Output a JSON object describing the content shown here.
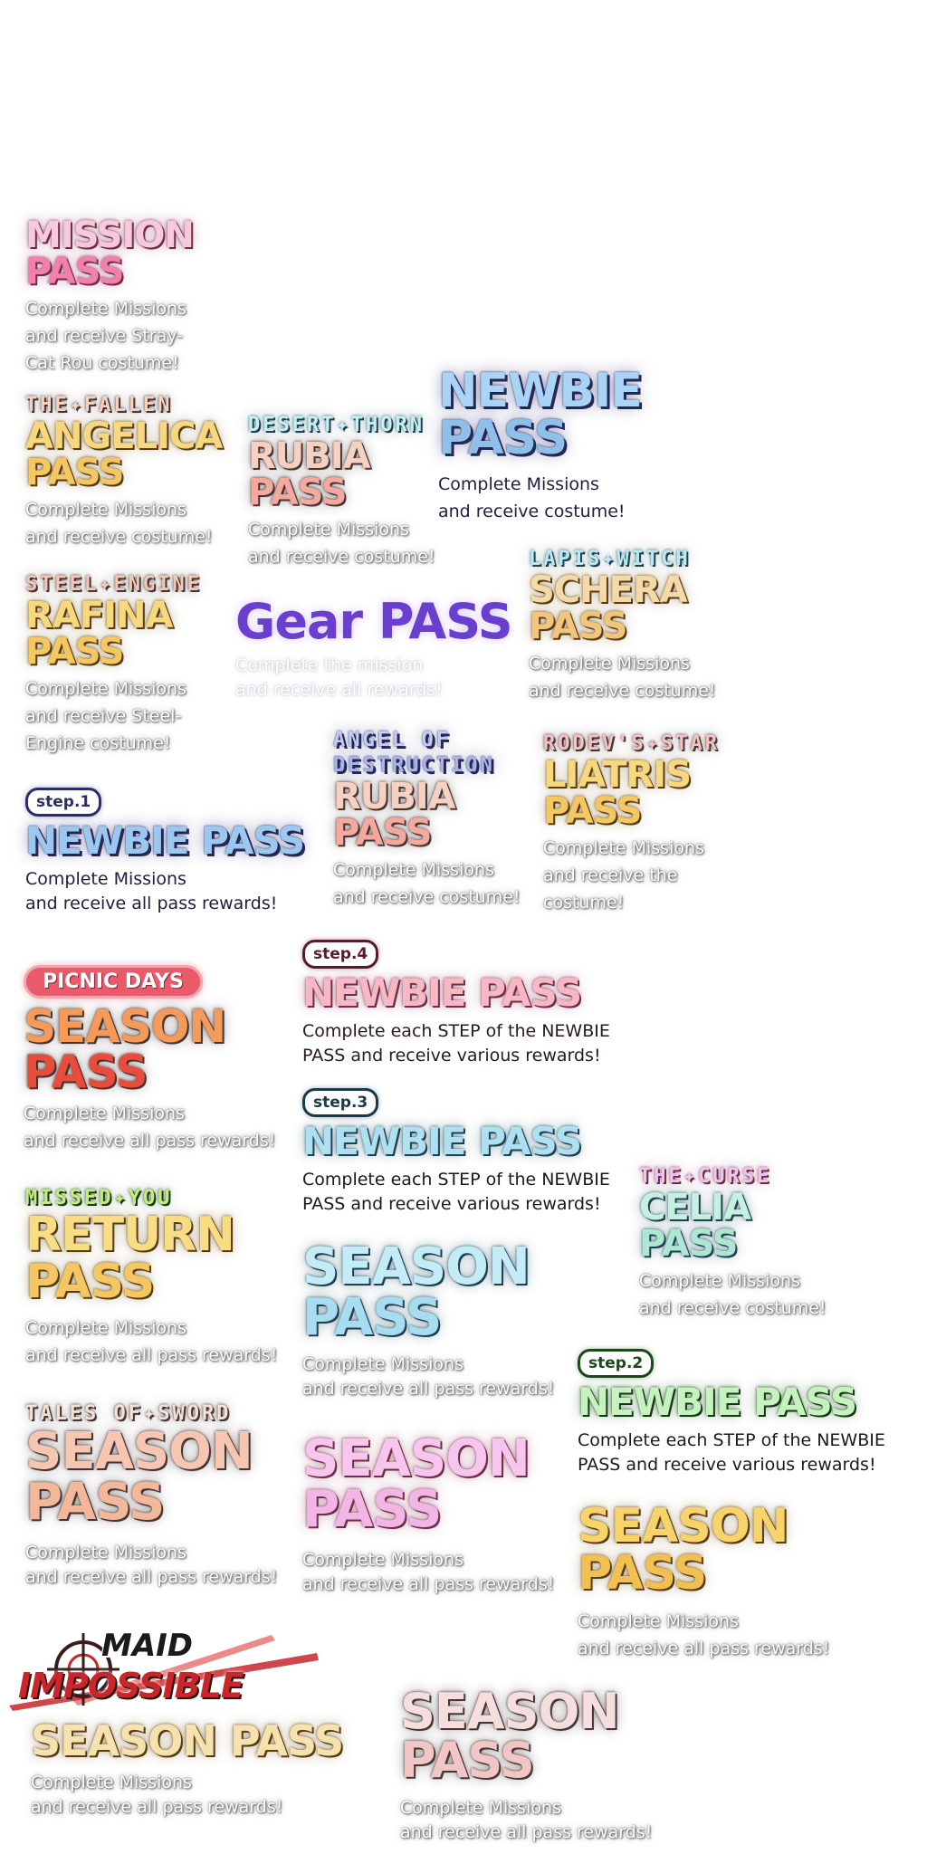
{
  "colors": {
    "pink": "#f27fae",
    "gold": "#f5c760",
    "orange": "#f08b4a",
    "red": "#e94a3a",
    "navy": "#8fc0ea",
    "teal": "#aee0f2",
    "violet": "#6a3fd0",
    "mint": "#b9ecd4",
    "peach": "#f3b79a",
    "lilac": "#f2b6e6",
    "lime": "#bfe36b"
  },
  "mission_pass": {
    "title1": "MISSION",
    "title2": "PASS",
    "desc": [
      "Complete Missions",
      "and receive Stray-",
      "Cat Rou costume!"
    ]
  },
  "angelica": {
    "eyebrow": "THE✦FALLEN",
    "title1": "ANGELICA",
    "title2": "PASS",
    "desc": [
      "Complete Missions",
      "and receive costume!"
    ]
  },
  "rubia_desert": {
    "eyebrow": "DESERT✦THORN",
    "title1": "RUBIA",
    "title2": "PASS",
    "desc": [
      "Complete Missions",
      "and receive costume!"
    ]
  },
  "newbie_big": {
    "title1": "NEWBIE",
    "title2": "PASS",
    "desc": [
      "Complete Missions",
      "and receive costume!"
    ]
  },
  "rafina": {
    "eyebrow": "STEEL✦ENGINE",
    "title1": "RAFINA",
    "title2": "PASS",
    "desc": [
      "Complete Missions",
      "and receive Steel-",
      "Engine costume!"
    ]
  },
  "gear": {
    "title": "Gear PASS",
    "desc": [
      "Complete the mission",
      "and receive all rewards!"
    ]
  },
  "schera": {
    "eyebrow": "LAPIS✦WITCH",
    "title1": "SCHERA",
    "title2": "PASS",
    "desc": [
      "Complete Missions",
      "and receive costume!"
    ]
  },
  "rubia_angel": {
    "eyebrow1": "ANGEL OF",
    "eyebrow2": "DESTRUCTION",
    "title1": "RUBIA",
    "title2": "PASS",
    "desc": [
      "Complete Missions",
      "and receive costume!"
    ]
  },
  "liatris": {
    "eyebrow": "RODEV'S✦STAR",
    "title1": "LIATRIS",
    "title2": "PASS",
    "desc": [
      "Complete Missions",
      "and receive the",
      "costume!"
    ]
  },
  "newbie_step1": {
    "step": "step.1",
    "title": "NEWBIE PASS",
    "desc": [
      "Complete Missions",
      "and receive all pass rewards!"
    ]
  },
  "picnic": {
    "badge": "PICNIC DAYS",
    "title1": "SEASON",
    "title2": "PASS",
    "desc": [
      "Complete Missions",
      "and receive all pass rewards!"
    ]
  },
  "newbie_step4": {
    "step": "step.4",
    "title": "NEWBIE PASS",
    "desc": [
      "Complete each STEP of the NEWBIE",
      "PASS and receive various rewards!"
    ]
  },
  "newbie_step3": {
    "step": "step.3",
    "title": "NEWBIE PASS",
    "desc": [
      "Complete each STEP of the NEWBIE",
      "PASS and receive various rewards!"
    ]
  },
  "return_pass": {
    "eyebrow": "MISSED✦YOU",
    "title1": "RETURN",
    "title2": "PASS",
    "desc": [
      "Complete Missions",
      "and receive all pass rewards!"
    ]
  },
  "season_teal": {
    "title1": "SEASON",
    "title2": "PASS",
    "desc": [
      "Complete Missions",
      "and receive all pass rewards!"
    ]
  },
  "celia": {
    "eyebrow": "THE✦CURSE",
    "title1": "CELIA",
    "title2": "PASS",
    "desc": [
      "Complete Missions",
      "and receive costume!"
    ]
  },
  "newbie_step2": {
    "step": "step.2",
    "title": "NEWBIE PASS",
    "desc": [
      "Complete each STEP of the NEWBIE",
      "PASS and receive various rewards!"
    ]
  },
  "tales": {
    "eyebrow": "TALES OF✦SWORD",
    "title1": "SEASON",
    "title2": "PASS",
    "desc": [
      "Complete Missions",
      "and receive all pass rewards!"
    ]
  },
  "season_lilac": {
    "title1": "SEASON",
    "title2": "PASS",
    "desc": [
      "Complete Missions",
      "and receive all pass rewards!"
    ]
  },
  "season_gold": {
    "title1": "SEASON",
    "title2": "PASS",
    "desc": [
      "Complete Missions",
      "and receive all pass rewards!"
    ]
  },
  "maid": {
    "logo1": "MAID",
    "logo2": "IMPOSSIBLE",
    "title": "SEASON PASS",
    "desc": [
      "Complete Missions",
      "and receive all pass rewards!"
    ]
  },
  "season_rose": {
    "title1": "SEASON",
    "title2": "PASS",
    "desc": [
      "Complete Missions",
      "and receive all pass rewards!"
    ]
  }
}
